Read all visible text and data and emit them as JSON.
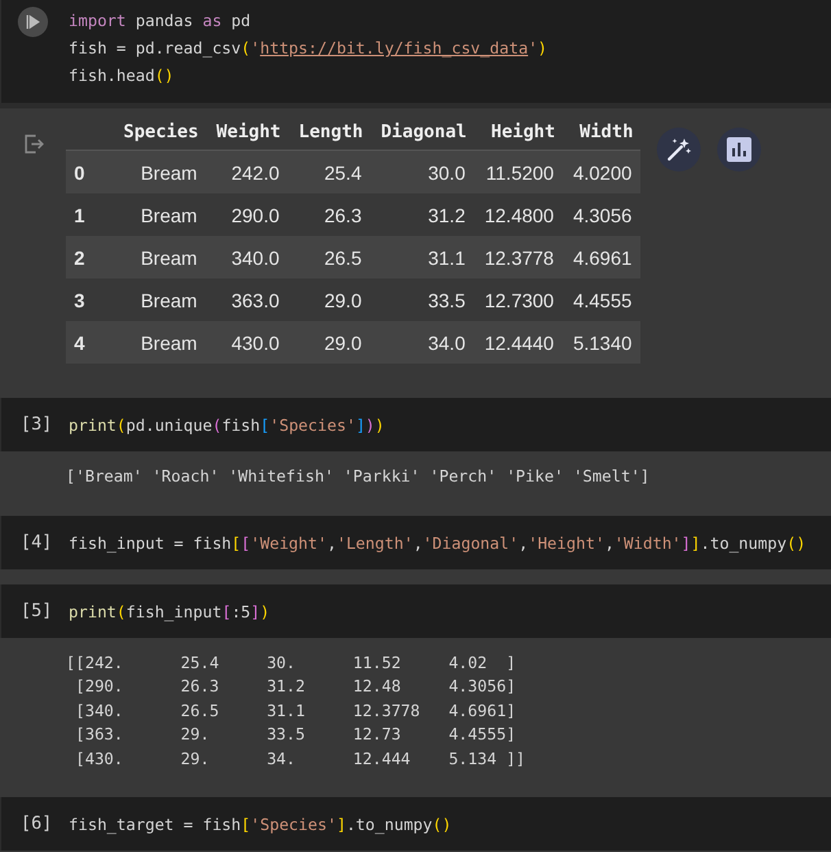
{
  "cells": [
    {
      "focused": true,
      "lines": [
        [
          {
            "kind": "keyword",
            "text": "import"
          },
          {
            "kind": "plain",
            "text": " pandas "
          },
          {
            "kind": "keyword",
            "text": "as"
          },
          {
            "kind": "plain",
            "text": " pd"
          }
        ],
        [
          {
            "kind": "plain",
            "text": "fish = pd.read_csv"
          },
          {
            "kind": "bracket1",
            "text": "("
          },
          {
            "kind": "string",
            "text": "'"
          },
          {
            "kind": "link",
            "text": "https://bit.ly/fish_csv_data"
          },
          {
            "kind": "string",
            "text": "'"
          },
          {
            "kind": "bracket1",
            "text": ")"
          }
        ],
        [
          {
            "kind": "plain",
            "text": "fish.head"
          },
          {
            "kind": "bracket1",
            "text": "()"
          }
        ]
      ],
      "output": {
        "kind": "table",
        "columns": [
          "",
          "Species",
          "Weight",
          "Length",
          "Diagonal",
          "Height",
          "Width"
        ],
        "rows": [
          [
            "0",
            "Bream",
            "242.0",
            "25.4",
            "30.0",
            "11.5200",
            "4.0200"
          ],
          [
            "1",
            "Bream",
            "290.0",
            "26.3",
            "31.2",
            "12.4800",
            "4.3056"
          ],
          [
            "2",
            "Bream",
            "340.0",
            "26.5",
            "31.1",
            "12.3778",
            "4.6961"
          ],
          [
            "3",
            "Bream",
            "363.0",
            "29.0",
            "33.5",
            "12.7300",
            "4.4555"
          ],
          [
            "4",
            "Bream",
            "430.0",
            "29.0",
            "34.0",
            "12.4440",
            "5.1340"
          ]
        ]
      }
    },
    {
      "focused": false,
      "prompt": "[3]",
      "lines": [
        [
          {
            "kind": "func",
            "text": "print"
          },
          {
            "kind": "bracket1",
            "text": "("
          },
          {
            "kind": "plain",
            "text": "pd.unique"
          },
          {
            "kind": "bracket2",
            "text": "("
          },
          {
            "kind": "plain",
            "text": "fish"
          },
          {
            "kind": "bracket3",
            "text": "["
          },
          {
            "kind": "string",
            "text": "'Species'"
          },
          {
            "kind": "bracket3",
            "text": "]"
          },
          {
            "kind": "bracket2",
            "text": ")"
          },
          {
            "kind": "bracket1",
            "text": ")"
          }
        ]
      ],
      "output": {
        "kind": "stream",
        "text": "['Bream' 'Roach' 'Whitefish' 'Parkki' 'Perch' 'Pike' 'Smelt']"
      }
    },
    {
      "focused": false,
      "prompt": "[4]",
      "lines": [
        [
          {
            "kind": "plain",
            "text": "fish_input = fish"
          },
          {
            "kind": "bracket1",
            "text": "["
          },
          {
            "kind": "bracket2",
            "text": "["
          },
          {
            "kind": "string",
            "text": "'Weight'"
          },
          {
            "kind": "plain",
            "text": ","
          },
          {
            "kind": "string",
            "text": "'Length'"
          },
          {
            "kind": "plain",
            "text": ","
          },
          {
            "kind": "string",
            "text": "'Diagonal'"
          },
          {
            "kind": "plain",
            "text": ","
          },
          {
            "kind": "string",
            "text": "'Height'"
          },
          {
            "kind": "plain",
            "text": ","
          },
          {
            "kind": "string",
            "text": "'Width'"
          },
          {
            "kind": "bracket2",
            "text": "]"
          },
          {
            "kind": "bracket1",
            "text": "]"
          },
          {
            "kind": "plain",
            "text": ".to_numpy"
          },
          {
            "kind": "bracket1",
            "text": "()"
          }
        ]
      ]
    },
    {
      "focused": false,
      "prompt": "[5]",
      "lines": [
        [
          {
            "kind": "func",
            "text": "print"
          },
          {
            "kind": "bracket1",
            "text": "("
          },
          {
            "kind": "plain",
            "text": "fish_input"
          },
          {
            "kind": "bracket2",
            "text": "["
          },
          {
            "kind": "plain",
            "text": ":5"
          },
          {
            "kind": "bracket2",
            "text": "]"
          },
          {
            "kind": "bracket1",
            "text": ")"
          }
        ]
      ],
      "output": {
        "kind": "stream",
        "text": "[[242.      25.4     30.      11.52     4.02  ]\n [290.      26.3     31.2     12.48     4.3056]\n [340.      26.5     31.1     12.3778   4.6961]\n [363.      29.      33.5     12.73     4.4555]\n [430.      29.      34.      12.444    5.134 ]]"
      }
    },
    {
      "focused": false,
      "prompt": "[6]",
      "lines": [
        [
          {
            "kind": "plain",
            "text": "fish_target = fish"
          },
          {
            "kind": "bracket1",
            "text": "["
          },
          {
            "kind": "string",
            "text": "'Species'"
          },
          {
            "kind": "bracket1",
            "text": "]"
          },
          {
            "kind": "plain",
            "text": ".to_numpy"
          },
          {
            "kind": "bracket1",
            "text": "()"
          }
        ]
      ]
    }
  ]
}
